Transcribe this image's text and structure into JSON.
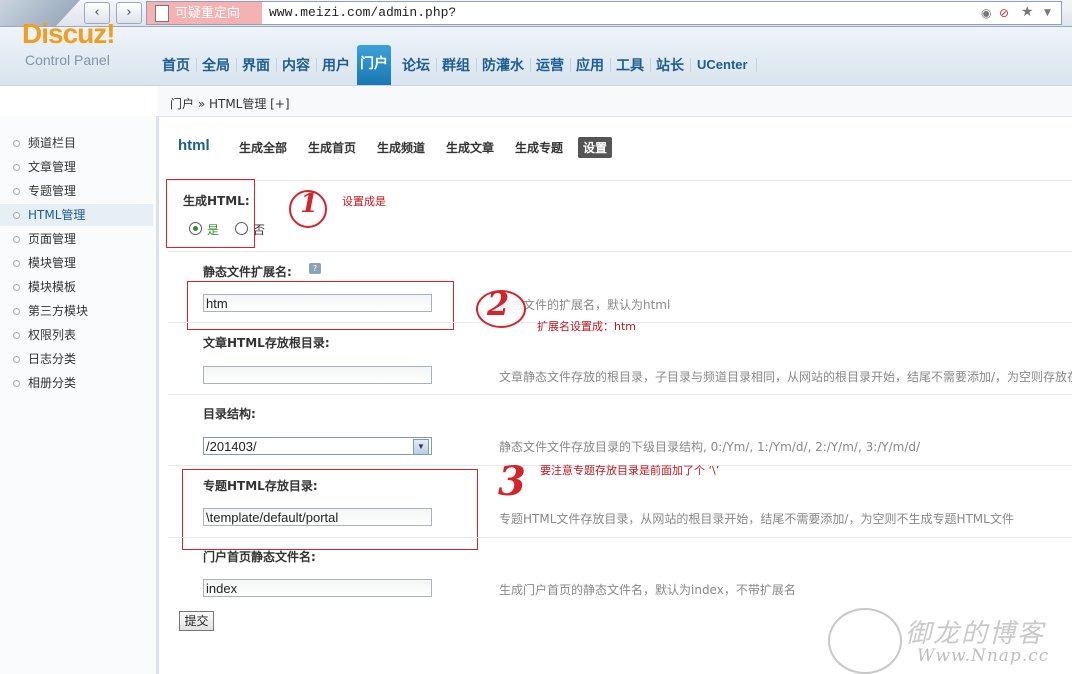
{
  "browser": {
    "redirect_label": "可疑重定向",
    "url": "www.meizi.com/admin.php?",
    "back_glyph": "‹",
    "forward_glyph": "›"
  },
  "header": {
    "logo": "Discuz!",
    "logo_sub": "Control Panel",
    "nav": [
      "首页",
      "全局",
      "界面",
      "内容",
      "用户",
      "门户",
      "论坛",
      "群组",
      "防灌水",
      "运营",
      "应用",
      "工具",
      "站长",
      "UCenter"
    ],
    "active_nav": "门户"
  },
  "breadcrumb": "门户 » HTML管理  [+]",
  "sidebar": {
    "items": [
      "频道栏目",
      "文章管理",
      "专题管理",
      "HTML管理",
      "页面管理",
      "模块管理",
      "模块模板",
      "第三方模块",
      "权限列表",
      "日志分类",
      "相册分类"
    ],
    "active": "HTML管理"
  },
  "subnav": {
    "title": "html",
    "tabs": [
      "生成全部",
      "生成首页",
      "生成频道",
      "生成文章",
      "生成专题",
      "设置"
    ],
    "active": "设置"
  },
  "form": {
    "gen_html_label": "生成HTML:",
    "radio_yes": "是",
    "radio_no": "否",
    "ext_label": "静态文件扩展名:",
    "ext_value": "htm",
    "ext_tip": "静态文件的扩展名，默认为html",
    "article_dir_label": "文章HTML存放根目录:",
    "article_dir_value": "",
    "article_dir_tip": "文章静态文件存放的根目录，子目录与频道目录相同，从网站的根目录开始，结尾不需要添加/，为空则存放在",
    "dir_struct_label": "目录结构:",
    "dir_struct_value": "/201403/",
    "dir_struct_tip": "静态文件文件存放目录的下级目录结构, 0:/Ym/, 1:/Ym/d/, 2:/Y/m/, 3:/Y/m/d/",
    "topic_dir_label": "专题HTML存放目录:",
    "topic_dir_value": "\\template/default/portal",
    "topic_dir_tip": "专题HTML文件存放目录，从网站的根目录开始，结尾不需要添加/，为空则不生成专题HTML文件",
    "index_name_label": "门户首页静态文件名:",
    "index_name_value": "index",
    "index_name_tip": "生成门户首页的静态文件名，默认为index，不带扩展名",
    "submit": "提交"
  },
  "annotations": {
    "n1": "1",
    "n1_text": "设置成是",
    "n2": "2",
    "n2_text": "扩展名设置成：htm",
    "n3": "3",
    "n3_text": "要注意专题存放目录是前面加了个 ‘\\’"
  },
  "watermark": {
    "text": "御龙的博客",
    "url": "Www.Nnap.cc"
  },
  "colors": {
    "accent": "#1d5d92",
    "logo": "#f29d1d",
    "annotation_red": "#d6232a"
  }
}
